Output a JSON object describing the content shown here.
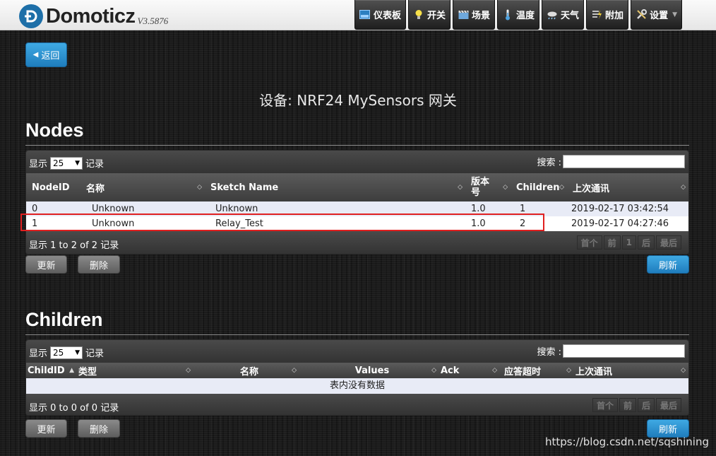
{
  "app": {
    "logo_text": "Domoticz",
    "version": "V3.5876"
  },
  "nav": [
    {
      "label": "仪表板",
      "icon": "dashboard-icon"
    },
    {
      "label": "开关",
      "icon": "lightbulb-icon"
    },
    {
      "label": "场景",
      "icon": "clapperboard-icon"
    },
    {
      "label": "温度",
      "icon": "thermometer-icon"
    },
    {
      "label": "天气",
      "icon": "weather-icon"
    },
    {
      "label": "附加",
      "icon": "utility-icon"
    },
    {
      "label": "设置",
      "icon": "tools-icon"
    }
  ],
  "back_label": "返回",
  "page_title": "设备: NRF24 MySensors 网关",
  "nodes": {
    "heading": "Nodes",
    "length_prefix": "显示",
    "length_value": "25",
    "length_suffix": "记录",
    "search_label": "搜索 :",
    "columns": [
      "NodeID",
      "名称",
      "Sketch Name",
      "版本号",
      "Children",
      "上次通讯"
    ],
    "rows": [
      {
        "id": "0",
        "name": "Unknown",
        "sketch": "Unknown",
        "version": "1.0",
        "children": "1",
        "last_seen": "2019-02-17 03:42:54"
      },
      {
        "id": "1",
        "name": "Unknown",
        "sketch": "Relay_Test",
        "version": "1.0",
        "children": "2",
        "last_seen": "2019-02-17 04:27:46"
      }
    ],
    "info": "显示 1 to 2 of 2 记录",
    "pager": [
      "首个",
      "前",
      "1",
      "后",
      "最后"
    ],
    "update_label": "更新",
    "delete_label": "删除",
    "refresh_label": "刷新"
  },
  "children": {
    "heading": "Children",
    "length_prefix": "显示",
    "length_value": "25",
    "length_suffix": "记录",
    "search_label": "搜索 :",
    "columns": [
      "ChildID",
      "类型",
      "名称",
      "Values",
      "Ack",
      "应答超时",
      "上次通讯"
    ],
    "empty_text": "表内没有数据",
    "info": "显示 0 to 0 of 0 记录",
    "pager": [
      "首个",
      "前",
      "后",
      "最后"
    ],
    "update_label": "更新",
    "delete_label": "删除",
    "refresh_label": "刷新"
  },
  "watermark": "https://blog.csdn.net/sqshining",
  "colors": {
    "accent_blue": "#2b8fd0",
    "highlight_red": "#e02020"
  }
}
